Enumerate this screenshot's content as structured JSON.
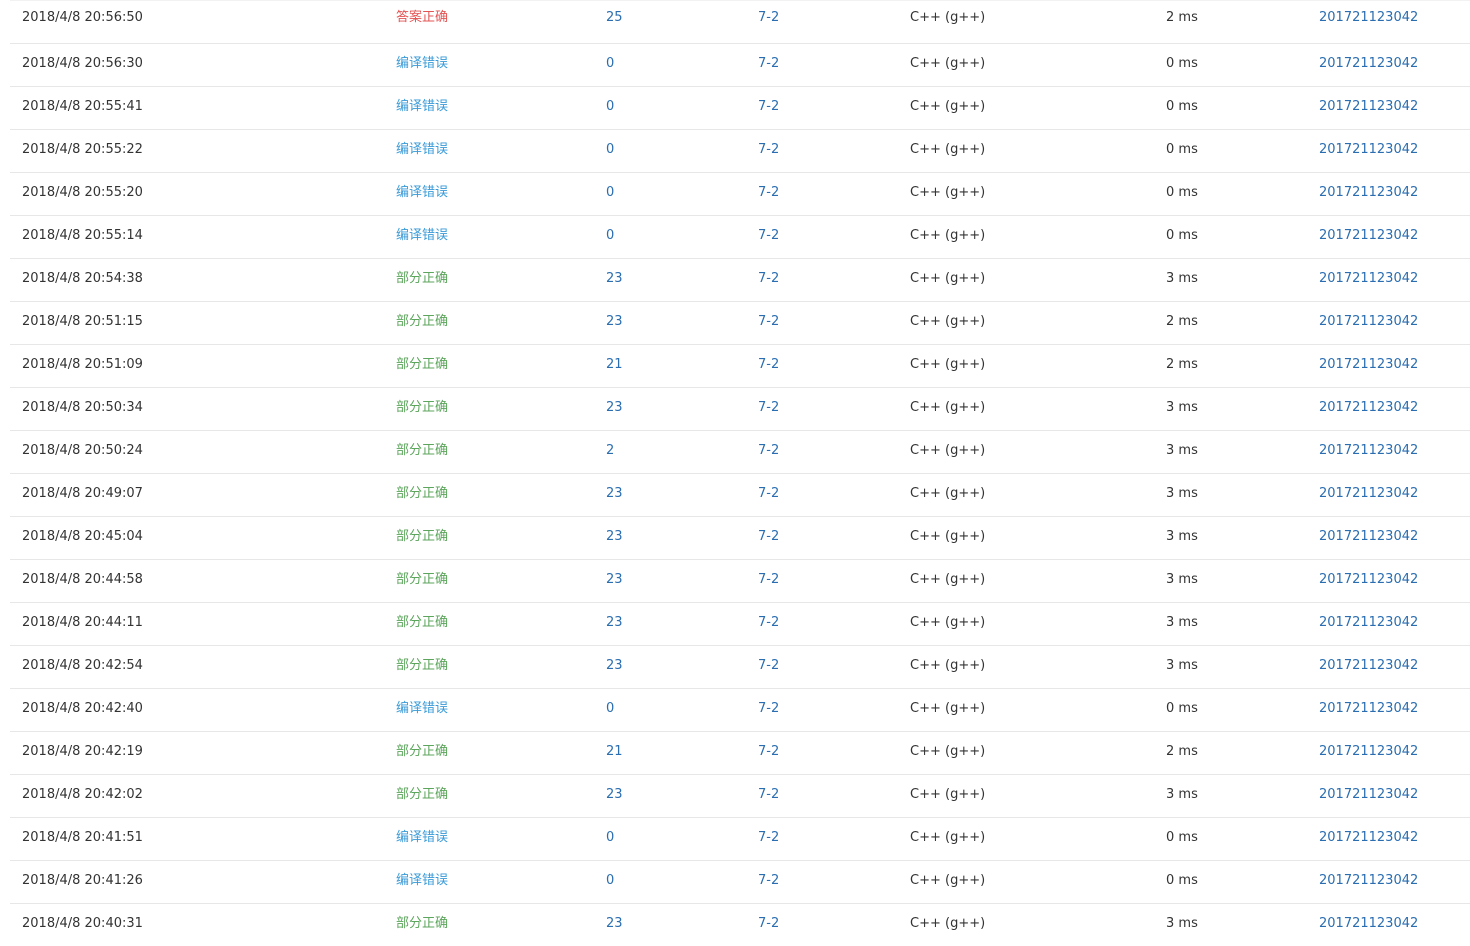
{
  "colors": {
    "accepted": "#e35454",
    "compile_error": "#3a9bd8",
    "partial": "#5ca55c",
    "link": "#2a6db0",
    "row_border": "#e7e7e7"
  },
  "submissions": [
    {
      "time": "2018/4/8 20:56:50",
      "status": "答案正确",
      "status_type": "accepted",
      "score": "25",
      "problem": "7-2",
      "language": "C++ (g++)",
      "time_cost": "2 ms",
      "user": "201721123042"
    },
    {
      "time": "2018/4/8 20:56:30",
      "status": "编译错误",
      "status_type": "compile",
      "score": "0",
      "problem": "7-2",
      "language": "C++ (g++)",
      "time_cost": "0 ms",
      "user": "201721123042"
    },
    {
      "time": "2018/4/8 20:55:41",
      "status": "编译错误",
      "status_type": "compile",
      "score": "0",
      "problem": "7-2",
      "language": "C++ (g++)",
      "time_cost": "0 ms",
      "user": "201721123042"
    },
    {
      "time": "2018/4/8 20:55:22",
      "status": "编译错误",
      "status_type": "compile",
      "score": "0",
      "problem": "7-2",
      "language": "C++ (g++)",
      "time_cost": "0 ms",
      "user": "201721123042"
    },
    {
      "time": "2018/4/8 20:55:20",
      "status": "编译错误",
      "status_type": "compile",
      "score": "0",
      "problem": "7-2",
      "language": "C++ (g++)",
      "time_cost": "0 ms",
      "user": "201721123042"
    },
    {
      "time": "2018/4/8 20:55:14",
      "status": "编译错误",
      "status_type": "compile",
      "score": "0",
      "problem": "7-2",
      "language": "C++ (g++)",
      "time_cost": "0 ms",
      "user": "201721123042"
    },
    {
      "time": "2018/4/8 20:54:38",
      "status": "部分正确",
      "status_type": "partial",
      "score": "23",
      "problem": "7-2",
      "language": "C++ (g++)",
      "time_cost": "3 ms",
      "user": "201721123042"
    },
    {
      "time": "2018/4/8 20:51:15",
      "status": "部分正确",
      "status_type": "partial",
      "score": "23",
      "problem": "7-2",
      "language": "C++ (g++)",
      "time_cost": "2 ms",
      "user": "201721123042"
    },
    {
      "time": "2018/4/8 20:51:09",
      "status": "部分正确",
      "status_type": "partial",
      "score": "21",
      "problem": "7-2",
      "language": "C++ (g++)",
      "time_cost": "2 ms",
      "user": "201721123042"
    },
    {
      "time": "2018/4/8 20:50:34",
      "status": "部分正确",
      "status_type": "partial",
      "score": "23",
      "problem": "7-2",
      "language": "C++ (g++)",
      "time_cost": "3 ms",
      "user": "201721123042"
    },
    {
      "time": "2018/4/8 20:50:24",
      "status": "部分正确",
      "status_type": "partial",
      "score": "2",
      "problem": "7-2",
      "language": "C++ (g++)",
      "time_cost": "3 ms",
      "user": "201721123042"
    },
    {
      "time": "2018/4/8 20:49:07",
      "status": "部分正确",
      "status_type": "partial",
      "score": "23",
      "problem": "7-2",
      "language": "C++ (g++)",
      "time_cost": "3 ms",
      "user": "201721123042"
    },
    {
      "time": "2018/4/8 20:45:04",
      "status": "部分正确",
      "status_type": "partial",
      "score": "23",
      "problem": "7-2",
      "language": "C++ (g++)",
      "time_cost": "3 ms",
      "user": "201721123042"
    },
    {
      "time": "2018/4/8 20:44:58",
      "status": "部分正确",
      "status_type": "partial",
      "score": "23",
      "problem": "7-2",
      "language": "C++ (g++)",
      "time_cost": "3 ms",
      "user": "201721123042"
    },
    {
      "time": "2018/4/8 20:44:11",
      "status": "部分正确",
      "status_type": "partial",
      "score": "23",
      "problem": "7-2",
      "language": "C++ (g++)",
      "time_cost": "3 ms",
      "user": "201721123042"
    },
    {
      "time": "2018/4/8 20:42:54",
      "status": "部分正确",
      "status_type": "partial",
      "score": "23",
      "problem": "7-2",
      "language": "C++ (g++)",
      "time_cost": "3 ms",
      "user": "201721123042"
    },
    {
      "time": "2018/4/8 20:42:40",
      "status": "编译错误",
      "status_type": "compile",
      "score": "0",
      "problem": "7-2",
      "language": "C++ (g++)",
      "time_cost": "0 ms",
      "user": "201721123042"
    },
    {
      "time": "2018/4/8 20:42:19",
      "status": "部分正确",
      "status_type": "partial",
      "score": "21",
      "problem": "7-2",
      "language": "C++ (g++)",
      "time_cost": "2 ms",
      "user": "201721123042"
    },
    {
      "time": "2018/4/8 20:42:02",
      "status": "部分正确",
      "status_type": "partial",
      "score": "23",
      "problem": "7-2",
      "language": "C++ (g++)",
      "time_cost": "3 ms",
      "user": "201721123042"
    },
    {
      "time": "2018/4/8 20:41:51",
      "status": "编译错误",
      "status_type": "compile",
      "score": "0",
      "problem": "7-2",
      "language": "C++ (g++)",
      "time_cost": "0 ms",
      "user": "201721123042"
    },
    {
      "time": "2018/4/8 20:41:26",
      "status": "编译错误",
      "status_type": "compile",
      "score": "0",
      "problem": "7-2",
      "language": "C++ (g++)",
      "time_cost": "0 ms",
      "user": "201721123042"
    },
    {
      "time": "2018/4/8 20:40:31",
      "status": "部分正确",
      "status_type": "partial",
      "score": "23",
      "problem": "7-2",
      "language": "C++ (g++)",
      "time_cost": "3 ms",
      "user": "201721123042"
    }
  ]
}
